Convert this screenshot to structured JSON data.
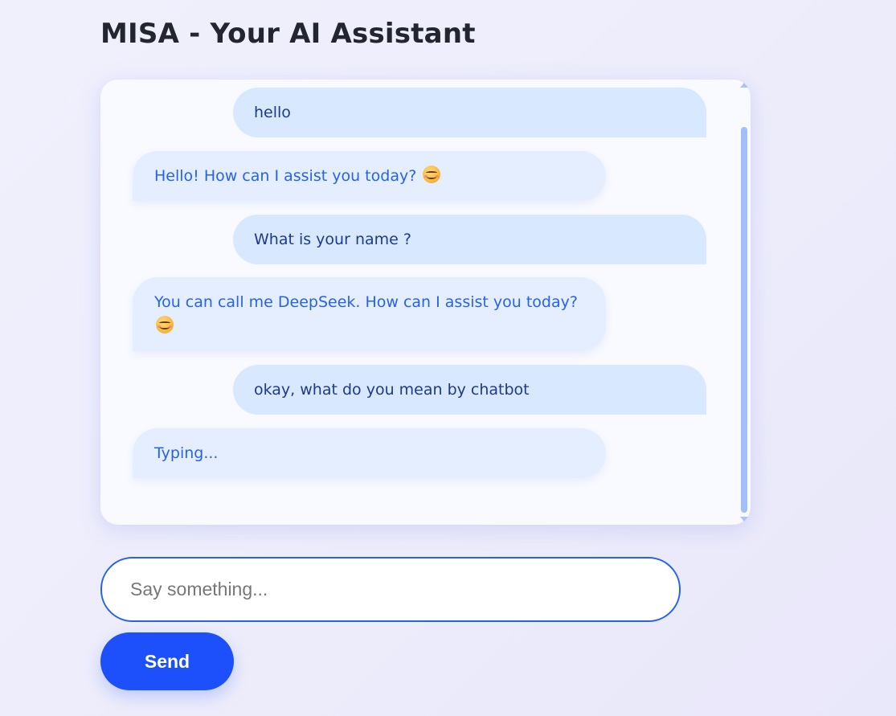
{
  "app": {
    "title": "MISA - Your AI Assistant"
  },
  "chat": {
    "messages": [
      {
        "role": "user",
        "text": "hello"
      },
      {
        "role": "bot",
        "text": "Hello! How can I assist you today?",
        "emoji": "smiling-face-icon"
      },
      {
        "role": "user",
        "text": "What is your name ?"
      },
      {
        "role": "bot",
        "text": "You can call me DeepSeek. How can I assist you today?",
        "emoji": "smiling-face-icon"
      },
      {
        "role": "user",
        "text": "okay, what do you mean by chatbot"
      },
      {
        "role": "bot",
        "text": "Typing..."
      }
    ]
  },
  "composer": {
    "input_value": "",
    "input_placeholder": "Say something...",
    "send_label": "Send"
  },
  "colors": {
    "accent": "#1d4ffb",
    "user_bubble_bg": "#d8e8fe",
    "user_bubble_text": "#1e3a8a",
    "bot_bubble_bg": "#e5eefe",
    "bot_bubble_text": "#2563eb",
    "input_border": "#2563eb",
    "scrollbar_thumb": "#a3bffa"
  }
}
